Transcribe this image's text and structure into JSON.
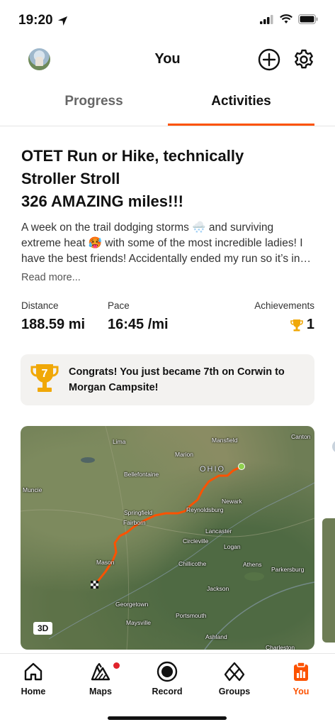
{
  "status_bar": {
    "time": "19:20"
  },
  "header": {
    "title": "You"
  },
  "tabs": [
    {
      "label": "Progress"
    },
    {
      "label": "Activities"
    }
  ],
  "activity": {
    "title_line1": "OTET Run or Hike, technically",
    "title_line2": "Stroller Stroll",
    "title_line3": "326 AMAZING miles!!!",
    "description": "A week on the trail dodging storms 🌨️ and surviving extreme heat 🥵 with some of the most incredible ladies! I have the best friends! Accidentally ended my run so it’s in…",
    "read_more": "Read more...",
    "stats": {
      "distance_label": "Distance",
      "distance_value": "188.59 mi",
      "pace_label": "Pace",
      "pace_value": "16:45 /mi",
      "achievements_label": "Achievements",
      "achievements_value": "1"
    },
    "congrats": {
      "rank": "7",
      "text": "Congrats! You just became 7th on Corwin to Morgan Campsite!"
    }
  },
  "map": {
    "labels": {
      "lima": "Lima",
      "mansfield": "Mansfield",
      "canton": "Canton",
      "marion": "Marion",
      "ohio": "OHIO",
      "bellefontaine": "Bellefontaine",
      "muncie": "Muncie",
      "newark": "Newark",
      "springfield": "Springfield",
      "reynoldsburg": "Reynoldsburg",
      "fairborn": "Fairborn",
      "lancaster": "Lancaster",
      "circleville": "Circleville",
      "logan": "Logan",
      "mason": "Mason",
      "chillicothe": "Chillicothe",
      "athens": "Athens",
      "parkersburg": "Parkersburg",
      "jackson": "Jackson",
      "georgetown": "Georgetown",
      "portsmouth": "Portsmouth",
      "maysville": "Maysville",
      "ashland": "Ashland",
      "charleston": "Charleston"
    },
    "badge_3d": "3D",
    "route_color": "#fc5200",
    "start_color": "#8fd14f"
  },
  "bottom_nav": [
    {
      "label": "Home",
      "icon": "home-icon"
    },
    {
      "label": "Maps",
      "icon": "maps-icon"
    },
    {
      "label": "Record",
      "icon": "record-icon"
    },
    {
      "label": "Groups",
      "icon": "groups-icon"
    },
    {
      "label": "You",
      "icon": "you-icon"
    }
  ],
  "colors": {
    "accent": "#fc5200",
    "notification_dot": "#e0232b",
    "trophy": "#f0a808"
  }
}
